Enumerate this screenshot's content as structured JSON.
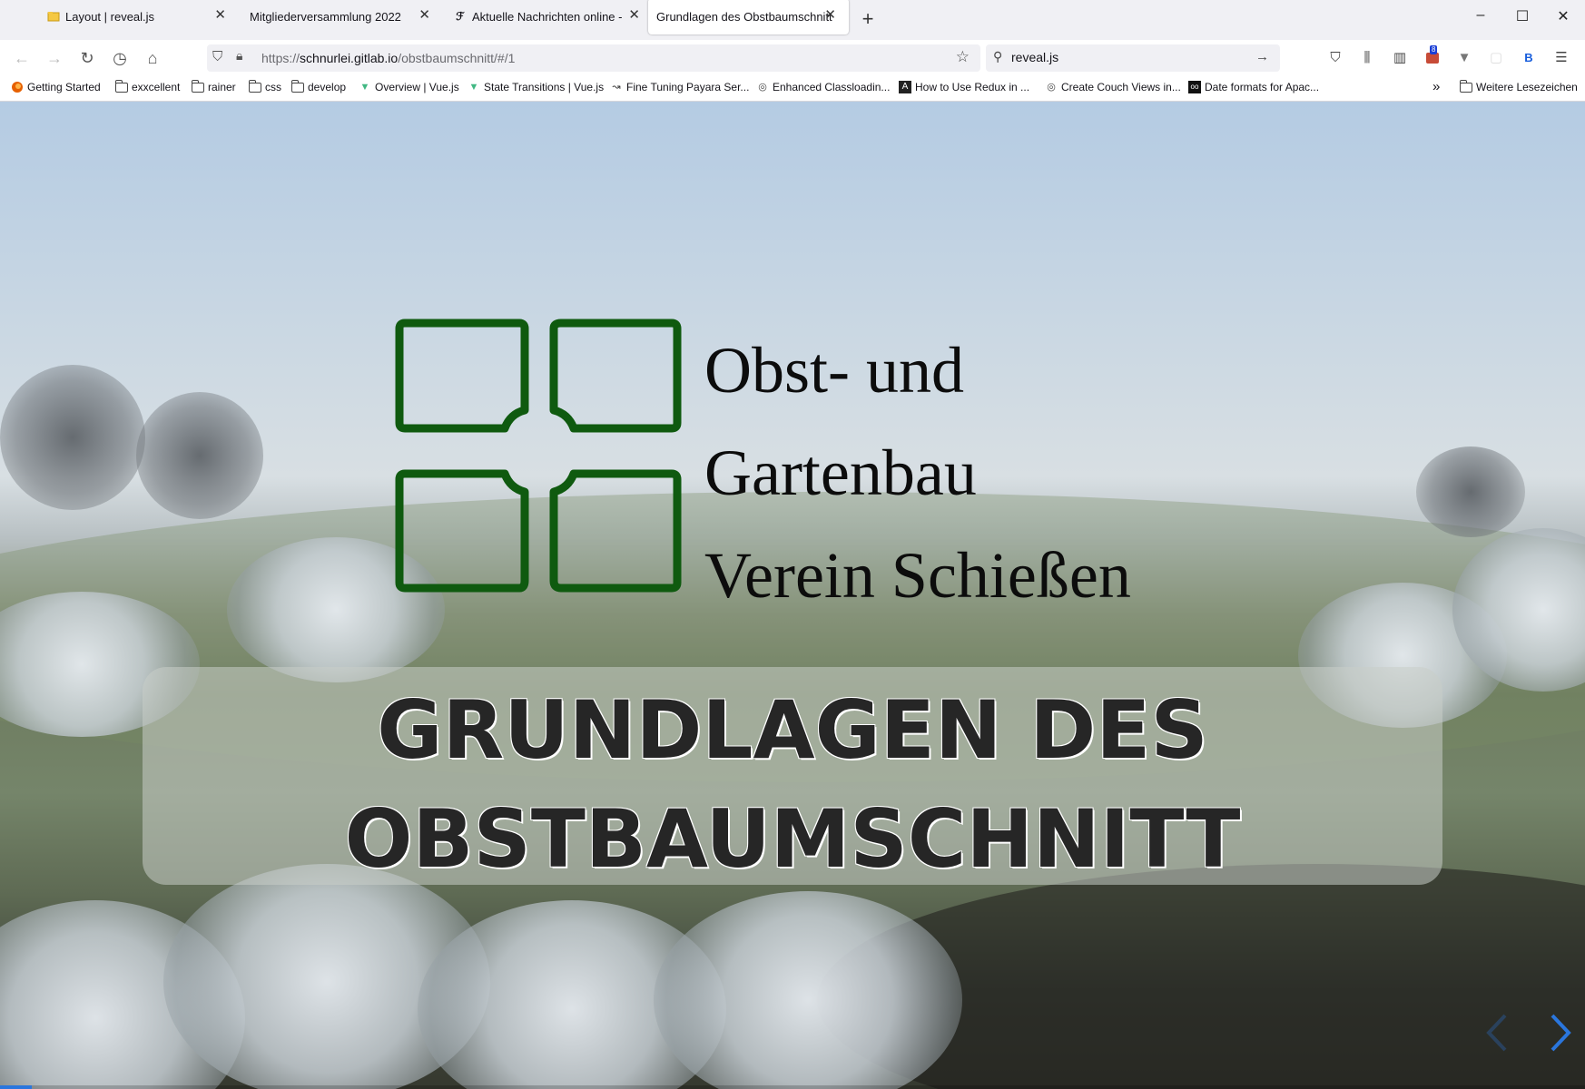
{
  "tabs": [
    {
      "title": "Layout | reveal.js",
      "favicon": "folder-icon",
      "active": false
    },
    {
      "title": "Mitgliederversammlung 2022",
      "favicon": "none",
      "active": false
    },
    {
      "title": "Aktuelle Nachrichten online - FA",
      "favicon": "faz-icon",
      "active": false
    },
    {
      "title": "Grundlagen des Obstbaumschnitt",
      "favicon": "none",
      "active": true
    }
  ],
  "window_controls": {
    "minimize": "–",
    "maximize": "☐",
    "close": "✕"
  },
  "navbar": {
    "url_scheme": "https://",
    "url_host": "schnurlei.gitlab.io",
    "url_path": "/obstbaumschnitt/#/1",
    "search_value": "reveal.js",
    "extension_badge": "8"
  },
  "bookmarks": [
    {
      "label": "Getting Started",
      "icon": "firefox-icon"
    },
    {
      "label": "exxcellent",
      "icon": "folder-icon"
    },
    {
      "label": "rainer",
      "icon": "folder-icon"
    },
    {
      "label": "css",
      "icon": "folder-icon"
    },
    {
      "label": "develop",
      "icon": "folder-icon"
    },
    {
      "label": "Overview | Vue.js",
      "icon": "vue-icon"
    },
    {
      "label": "State Transitions | Vue.js",
      "icon": "vue-icon"
    },
    {
      "label": "Fine Tuning Payara Ser...",
      "icon": "payara-icon"
    },
    {
      "label": "Enhanced Classloadin...",
      "icon": "globe-icon"
    },
    {
      "label": "How to Use Redux in ...",
      "icon": "a-logo-icon"
    },
    {
      "label": "Create Couch Views in...",
      "icon": "globe-icon"
    },
    {
      "label": "Date formats for Apac...",
      "icon": "oo-icon"
    }
  ],
  "bookmarks_overflow": "»",
  "other_bookmarks": "Weitere Lesezeichen",
  "slide": {
    "logo_lines": [
      "Obst- und",
      "Gartenbau",
      "Verein Schießen"
    ],
    "title_line1": "GRUNDLAGEN DES",
    "title_line2": "OBSTBAUMSCHNITT",
    "progress_fraction": 0.02
  },
  "colors": {
    "logo_green": "#0f5a0f",
    "progress": "#2a76dd",
    "nav_arrow": "#2a76dd"
  }
}
